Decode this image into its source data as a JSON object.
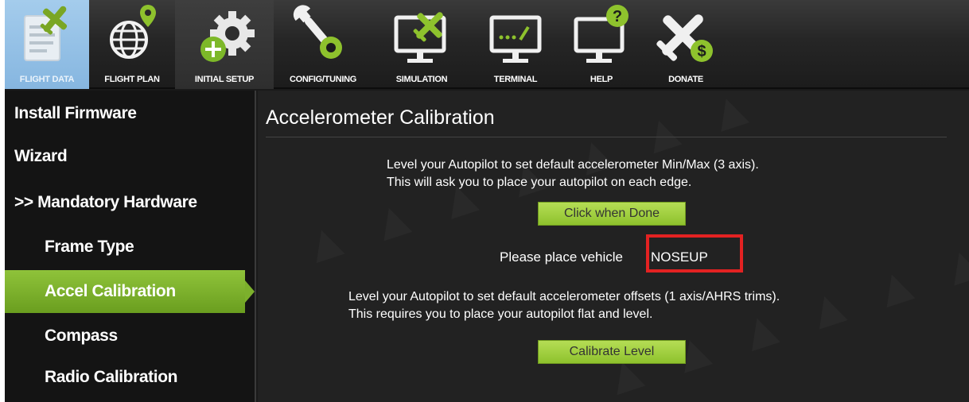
{
  "toolbar": {
    "buttons": [
      {
        "label": "FLIGHT DATA",
        "icon": "flight-data-icon",
        "active": true
      },
      {
        "label": "FLIGHT PLAN",
        "icon": "flight-plan-icon"
      },
      {
        "label": "INITIAL SETUP",
        "icon": "initial-setup-icon",
        "hot": true
      },
      {
        "label": "CONFIG/TUNING",
        "icon": "config-tuning-icon"
      },
      {
        "label": "SIMULATION",
        "icon": "simulation-icon"
      },
      {
        "label": "TERMINAL",
        "icon": "terminal-icon"
      },
      {
        "label": "HELP",
        "icon": "help-icon"
      },
      {
        "label": "DONATE",
        "icon": "donate-icon"
      }
    ]
  },
  "sidebar": {
    "items": [
      {
        "label": "Install Firmware"
      },
      {
        "label": "Wizard"
      },
      {
        "label": ">> Mandatory Hardware"
      },
      {
        "label": "Frame Type"
      },
      {
        "label": "Accel Calibration",
        "selected": true
      },
      {
        "label": "Compass"
      },
      {
        "label": "Radio Calibration"
      }
    ]
  },
  "main": {
    "title": "Accelerometer Calibration",
    "accel_text_1": "Level your Autopilot to set default accelerometer Min/Max (3 axis).",
    "accel_text_2": "This will ask you to place your autopilot on each edge.",
    "click_when_done_label": "Click when Done",
    "prompt_label": "Please place vehicle",
    "prompt_value": "NOSEUP",
    "level_text_1": "Level your Autopilot to set default accelerometer offsets (1 axis/AHRS trims).",
    "level_text_2": "This requires you to place your autopilot flat and level.",
    "calibrate_level_label": "Calibrate Level"
  },
  "colors": {
    "accent_green": "#8ec22d",
    "active_tab": "#86b6e0",
    "highlight_box": "#e32222",
    "background": "#222222"
  }
}
